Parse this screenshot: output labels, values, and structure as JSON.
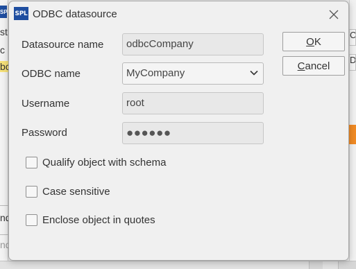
{
  "dialog": {
    "title": "ODBC datasource",
    "app_icon_text": "SPL",
    "fields": {
      "datasource_name": {
        "label": "Datasource name",
        "value": "odbcCompany"
      },
      "odbc_name": {
        "label": "ODBC name",
        "value": "MyCompany"
      },
      "username": {
        "label": "Username",
        "value": "root"
      },
      "password": {
        "label": "Password",
        "value": "●●●●●●"
      }
    },
    "buttons": {
      "ok_mnemonic": "O",
      "ok_rest": "K",
      "cancel_mnemonic": "C",
      "cancel_rest": "ancel"
    },
    "options": [
      {
        "label": "Qualify object with schema",
        "checked": false
      },
      {
        "label": "Case sensitive",
        "checked": false
      },
      {
        "label": "Enclose object in quotes",
        "checked": false
      }
    ]
  },
  "background": {
    "left_texts": [
      "st",
      "c",
      "bc",
      "nd",
      "nd"
    ],
    "right_texts": [
      "C",
      "Di"
    ]
  },
  "colors": {
    "app_icon": "#1f4ea0",
    "dialog_bg": "#f0f0f0",
    "highlight_orange": "#f08a24",
    "selection_yellow": "#f7e27a"
  },
  "icons": {
    "close": "close-icon",
    "dropdown": "chevron-down-icon",
    "app": "spl-app-icon"
  }
}
